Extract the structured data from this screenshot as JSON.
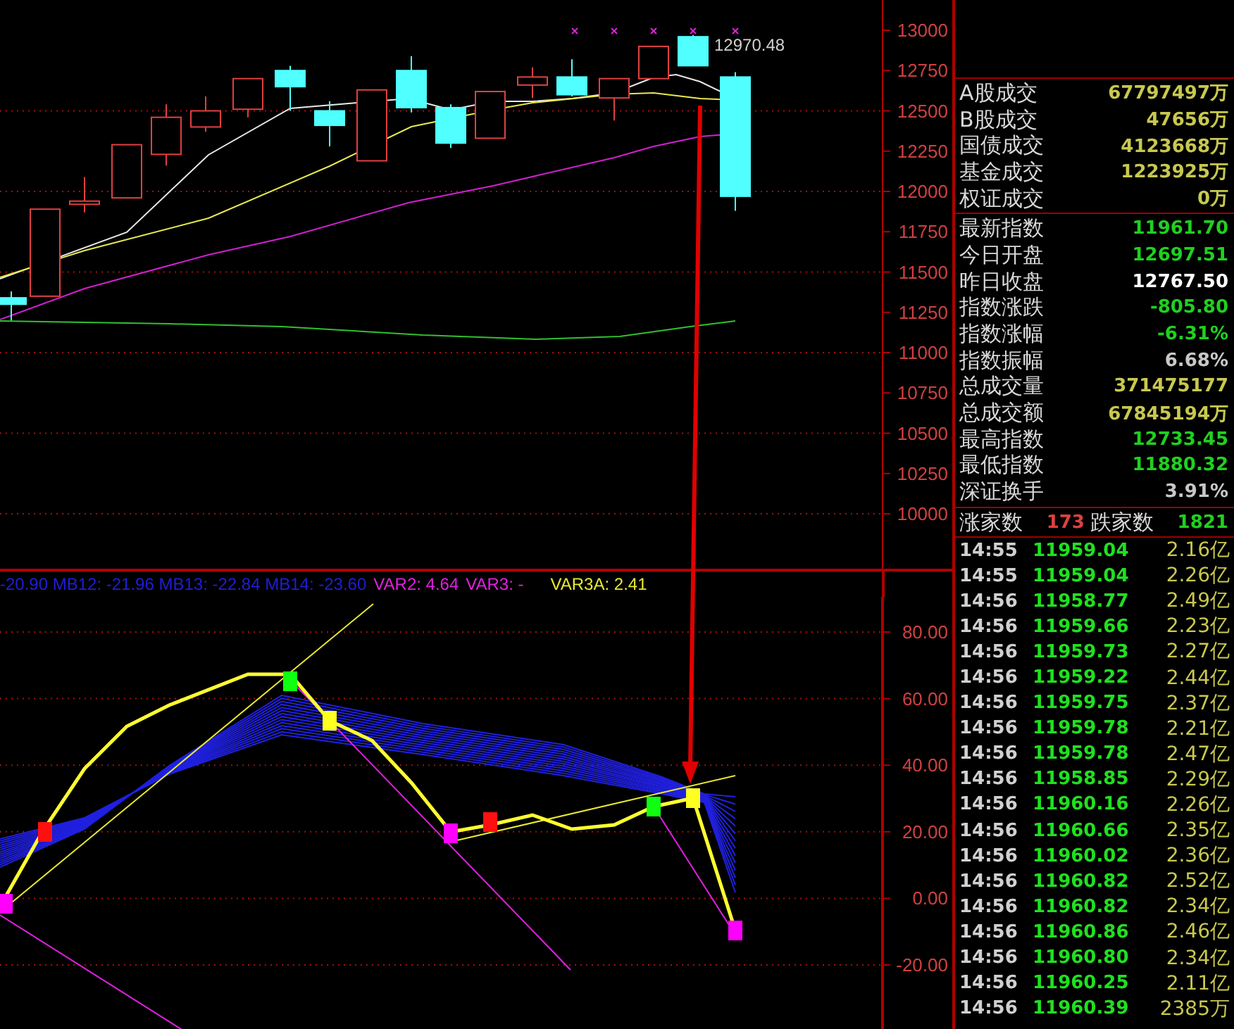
{
  "price_chart": {
    "ticks": [
      "13000",
      "12750",
      "12500",
      "12250",
      "12000",
      "11750",
      "11500",
      "11250",
      "11000",
      "10750",
      "10500",
      "10250",
      "10000"
    ],
    "last_price_label": "12970.48"
  },
  "indicator": {
    "legend": [
      {
        "text": "-20.90 MB12: -21.96 MB13: -22.84 MB14: -23.60",
        "color": "#1f1fd8"
      },
      {
        "text": "VAR2: 4.64",
        "color": "#e020e0"
      },
      {
        "text": "VAR3: -",
        "color": "#e020e0"
      },
      {
        "text": "VAR3A: 2.41",
        "color": "#e8e830"
      }
    ],
    "ticks": [
      "80.00",
      "60.00",
      "40.00",
      "20.00",
      "0.00",
      "-20.00"
    ]
  },
  "market_stats": [
    {
      "label": "A股成交",
      "value": "67797497万",
      "kind": "volume"
    },
    {
      "label": "B股成交",
      "value": "47656万",
      "kind": "volume"
    },
    {
      "label": "国债成交",
      "value": "4123668万",
      "kind": "volume"
    },
    {
      "label": "基金成交",
      "value": "1223925万",
      "kind": "volume"
    },
    {
      "label": "权证成交",
      "value": "0万",
      "kind": "volume"
    }
  ],
  "index_stats": [
    {
      "label": "最新指数",
      "value": "11961.70",
      "kind": "down"
    },
    {
      "label": "今日开盘",
      "value": "12697.51",
      "kind": "down"
    },
    {
      "label": "昨日收盘",
      "value": "12767.50",
      "kind": "flat"
    },
    {
      "label": "指数涨跌",
      "value": "-805.80",
      "kind": "down"
    },
    {
      "label": "指数涨幅",
      "value": "-6.31%",
      "kind": "down"
    },
    {
      "label": "指数振幅",
      "value": "6.68%",
      "kind": "neutral"
    },
    {
      "label": "总成交量",
      "value": "371475177",
      "kind": "volume"
    },
    {
      "label": "总成交额",
      "value": "67845194万",
      "kind": "volume"
    },
    {
      "label": "最高指数",
      "value": "12733.45",
      "kind": "down"
    },
    {
      "label": "最低指数",
      "value": "11880.32",
      "kind": "down"
    },
    {
      "label": "深证换手",
      "value": "3.91%",
      "kind": "neutral"
    }
  ],
  "breadth": {
    "up_label": "涨家数",
    "up_count": "173",
    "down_label": "跌家数",
    "down_count": "1821"
  },
  "trades": [
    {
      "time": "14:55",
      "price": "11959.04",
      "volume": "2.16亿"
    },
    {
      "time": "14:55",
      "price": "11959.04",
      "volume": "2.26亿"
    },
    {
      "time": "14:56",
      "price": "11958.77",
      "volume": "2.49亿"
    },
    {
      "time": "14:56",
      "price": "11959.66",
      "volume": "2.23亿"
    },
    {
      "time": "14:56",
      "price": "11959.73",
      "volume": "2.27亿"
    },
    {
      "time": "14:56",
      "price": "11959.22",
      "volume": "2.44亿"
    },
    {
      "time": "14:56",
      "price": "11959.75",
      "volume": "2.37亿"
    },
    {
      "time": "14:56",
      "price": "11959.78",
      "volume": "2.21亿"
    },
    {
      "time": "14:56",
      "price": "11959.78",
      "volume": "2.47亿"
    },
    {
      "time": "14:56",
      "price": "11958.85",
      "volume": "2.29亿"
    },
    {
      "time": "14:56",
      "price": "11960.16",
      "volume": "2.26亿"
    },
    {
      "time": "14:56",
      "price": "11960.66",
      "volume": "2.35亿"
    },
    {
      "time": "14:56",
      "price": "11960.02",
      "volume": "2.36亿"
    },
    {
      "time": "14:56",
      "price": "11960.82",
      "volume": "2.52亿"
    },
    {
      "time": "14:56",
      "price": "11960.82",
      "volume": "2.34亿"
    },
    {
      "time": "14:56",
      "price": "11960.86",
      "volume": "2.46亿"
    },
    {
      "time": "14:56",
      "price": "11960.80",
      "volume": "2.34亿"
    },
    {
      "time": "14:56",
      "price": "11960.25",
      "volume": "2.11亿"
    },
    {
      "time": "14:56",
      "price": "11960.39",
      "volume": "2385万"
    }
  ]
}
